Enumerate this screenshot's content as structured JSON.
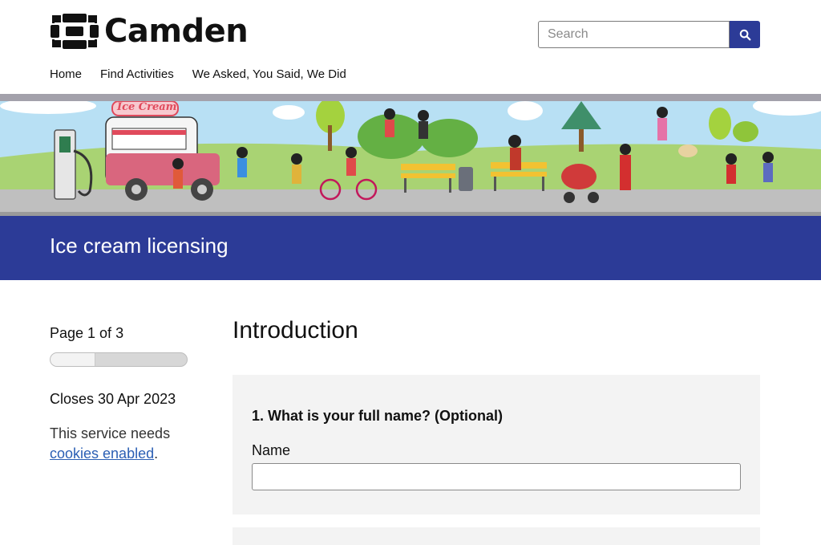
{
  "brand": {
    "name": "Camden",
    "accent": "#2c3b97"
  },
  "search": {
    "placeholder": "Search",
    "button_icon": "search-icon"
  },
  "nav": {
    "items": [
      "Home",
      "Find Activities",
      "We Asked, You Said, We Did"
    ]
  },
  "banner": {
    "van_sign": "Ice Cream"
  },
  "page": {
    "title": "Ice cream licensing"
  },
  "sidebar": {
    "page_count": "Page 1 of 3",
    "progress": 0.33,
    "closes": "Closes 30 Apr 2023",
    "cookies_text": "This service needs",
    "cookies_link": "cookies enabled",
    "cookies_end": "."
  },
  "main": {
    "heading": "Introduction",
    "question": {
      "title": "1. What is your full name? (Optional)",
      "label": "Name",
      "value": ""
    }
  }
}
